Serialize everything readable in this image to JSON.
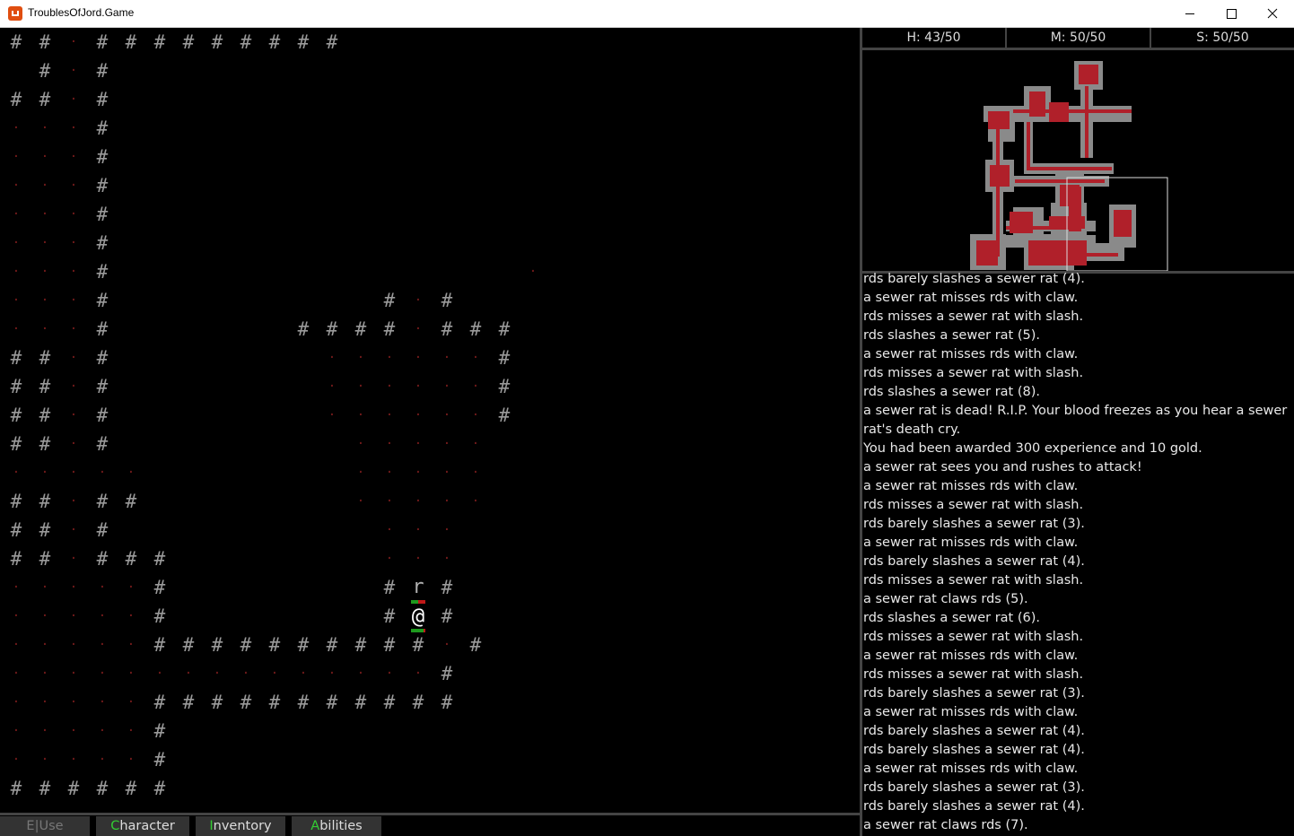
{
  "window": {
    "title": "TroublesOfJord.Game"
  },
  "stats": {
    "health": "H: 43/50",
    "mana": "M: 50/50",
    "stamina": "S: 50/50"
  },
  "log": [
    "rds barely slashes a sewer rat (4).",
    "a sewer rat misses rds with claw.",
    "rds misses a sewer rat with slash.",
    "rds slashes a sewer rat (5).",
    "a sewer rat misses rds with claw.",
    "rds misses a sewer rat with slash.",
    "rds slashes a sewer rat (8).",
    "a sewer rat is dead! R.I.P. Your blood freezes as you hear a sewer rat's death cry.",
    "You had been awarded 300 experience and 10 gold.",
    "a sewer rat sees you and rushes to attack!",
    "a sewer rat misses rds with claw.",
    "rds misses a sewer rat with slash.",
    "rds barely slashes a sewer rat (3).",
    "a sewer rat misses rds with claw.",
    "rds barely slashes a sewer rat (4).",
    "rds misses a sewer rat with slash.",
    "a sewer rat claws rds (5).",
    "rds slashes a sewer rat (6).",
    "rds misses a sewer rat with slash.",
    "a sewer rat misses rds with claw.",
    "rds misses a sewer rat with slash.",
    "rds barely slashes a sewer rat (3).",
    "a sewer rat misses rds with claw.",
    "rds barely slashes a sewer rat (4).",
    "rds barely slashes a sewer rat (4).",
    "a sewer rat misses rds with claw.",
    "rds barely slashes a sewer rat (3).",
    "rds barely slashes a sewer rat (4).",
    "a sewer rat claws rds (7)."
  ],
  "menu": {
    "use": {
      "hotkey": "E",
      "label": "|Use"
    },
    "character": {
      "hotkey": "C",
      "label": "haracter"
    },
    "inventory": {
      "hotkey": "I",
      "label": "nventory"
    },
    "abilities": {
      "hotkey": "A",
      "label": "bilities"
    }
  },
  "glyphs": {
    "wall": "#",
    "floor": "·",
    "player": "@",
    "rat": "r"
  },
  "colors": {
    "wall": "#9a9a9a",
    "floor": "#7a1c1c",
    "minimap_room": "#b0202a",
    "minimap_wall": "#8a8a8a",
    "hotkey": "#33cc33"
  },
  "player": {
    "hp_fraction": 0.86
  },
  "rat": {
    "hp_fraction": 0.5
  }
}
